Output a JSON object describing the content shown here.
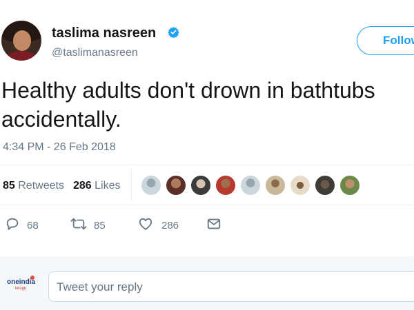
{
  "user": {
    "name": "taslima nasreen",
    "handle": "@taslimanasreen",
    "follow_label": "Follow"
  },
  "tweet": {
    "text_line1": "Healthy adults don't drown in bathtubs",
    "text_line2": "accidentally.",
    "timestamp": "4:34 PM - 26 Feb 2018"
  },
  "stats": {
    "retweets_count": "85",
    "retweets_label": "Retweets",
    "likes_count": "286",
    "likes_label": "Likes"
  },
  "actions": {
    "replies": "68",
    "retweets": "85",
    "likes": "286"
  },
  "reply": {
    "placeholder": "Tweet your reply"
  },
  "logo": {
    "text": "oneindia",
    "sub": "telugu"
  },
  "colors": {
    "accent": "#1da1f2",
    "muted": "#657786",
    "text": "#14171a",
    "divider": "#e6ecf0"
  },
  "icons": [
    "verified-badge-icon",
    "reply-icon",
    "retweet-icon",
    "like-icon",
    "message-icon"
  ]
}
